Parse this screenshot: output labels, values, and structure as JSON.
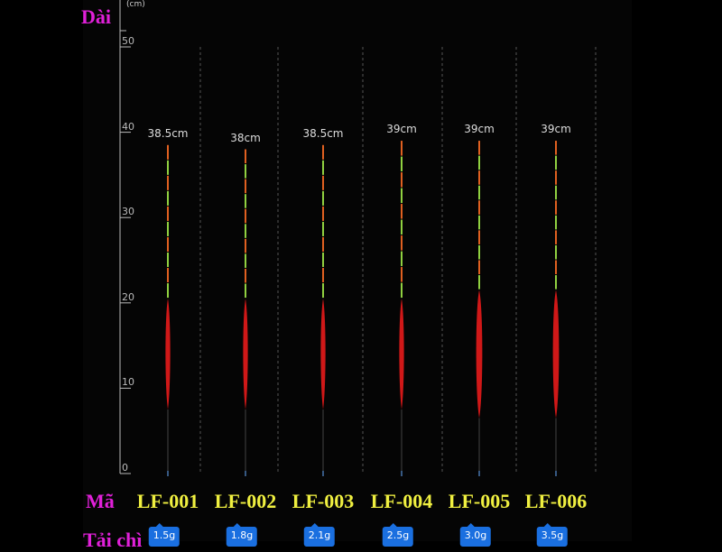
{
  "labels": {
    "length": "Dài",
    "unit": "(cm)",
    "code": "Mã",
    "weight": "Tải chì"
  },
  "axis": {
    "ticks": [
      "0",
      "10",
      "20",
      "30",
      "40",
      "50"
    ],
    "max": 50
  },
  "floats": [
    {
      "code": "LF-001",
      "length": "38.5cm",
      "length_cm": 38.5,
      "weight": "1.5g",
      "body_top_cm": 20.5,
      "body_bottom_cm": 7.5
    },
    {
      "code": "LF-002",
      "length": "38cm",
      "length_cm": 38,
      "weight": "1.8g",
      "body_top_cm": 20.5,
      "body_bottom_cm": 7.5
    },
    {
      "code": "LF-003",
      "length": "38.5cm",
      "length_cm": 38.5,
      "weight": "2.1g",
      "body_top_cm": 20.5,
      "body_bottom_cm": 7.5
    },
    {
      "code": "LF-004",
      "length": "39cm",
      "length_cm": 39,
      "weight": "2.5g",
      "body_top_cm": 20.5,
      "body_bottom_cm": 7.5
    },
    {
      "code": "LF-005",
      "length": "39cm",
      "length_cm": 39,
      "weight": "3.0g",
      "body_top_cm": 21.5,
      "body_bottom_cm": 6.5
    },
    {
      "code": "LF-006",
      "length": "39cm",
      "length_cm": 39,
      "weight": "3.5g",
      "body_top_cm": 21.5,
      "body_bottom_cm": 6.5
    }
  ],
  "colors": {
    "body": "#d01818",
    "tip_a": "#e06020",
    "tip_b": "#90d040",
    "label": "#e020d8",
    "code": "#f0f040",
    "badge": "#1a6fe0"
  }
}
